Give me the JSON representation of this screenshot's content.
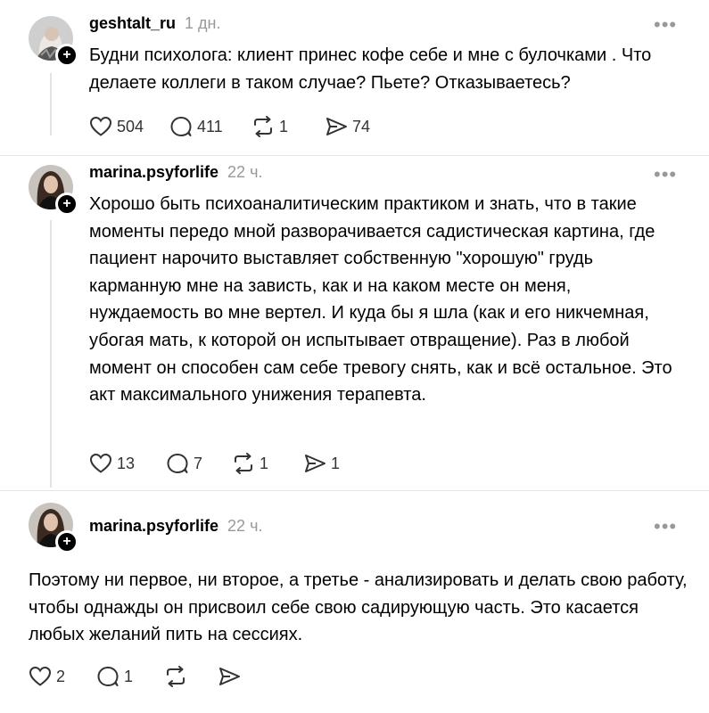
{
  "posts": [
    {
      "username": "geshtalt_ru",
      "time": "1 дн.",
      "more": "•••",
      "text": "Будни психолога: клиент принес кофе себе и мне с булочками . Что делаете коллеги в таком случае? Пьете? Отказываетесь?",
      "likes": "504",
      "comments": "411",
      "reposts": "1",
      "shares": "74"
    },
    {
      "username": "marina.psyforlife",
      "time": "22 ч.",
      "more": "•••",
      "text": "Хорошо быть психоаналитическим практиком и знать, что в такие моменты передо мной разворачивается садистическая картина, где пациент нарочито выставляет собственную \"хорошую\" грудь карманную мне на зависть, как и на каком месте он меня, нуждаемость во мне вертел. И куда бы я шла (как и его никчемная, убогая мать, к которой он испытывает отвращение). Раз в любой момент он способен сам себе тревогу снять, как и всё остальное. Это акт максимального унижения терапевта.",
      "likes": "13",
      "comments": "7",
      "reposts": "1",
      "shares": "1"
    },
    {
      "username": "marina.psyforlife",
      "time": "22 ч.",
      "more": "•••",
      "text": "Поэтому ни первое, ни второе, а третье - анализировать и делать свою работу, чтобы однажды он присвоил себе свою садирующую часть. Это касается любых желаний пить на сессиях.",
      "likes": "2",
      "comments": "1"
    }
  ],
  "plus_glyph": "+",
  "icons": [
    "heart-icon",
    "comment-icon",
    "repost-icon",
    "share-icon",
    "more-icon",
    "plus-icon"
  ]
}
